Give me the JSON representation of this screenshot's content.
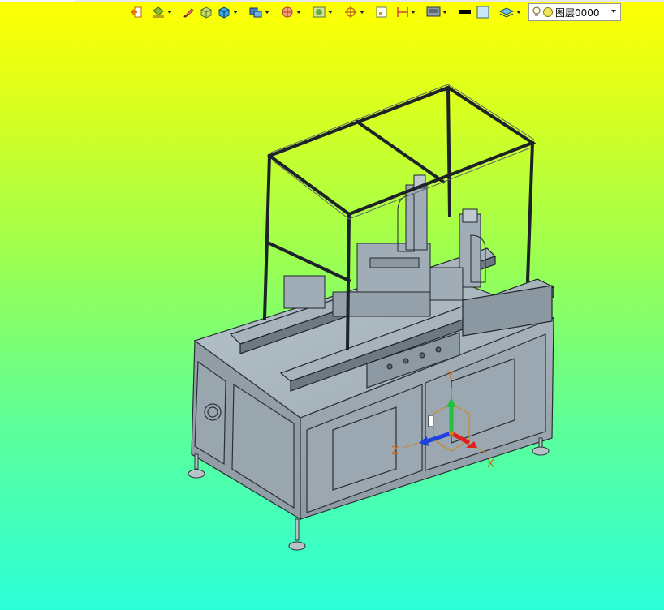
{
  "toolbar": {
    "layer": {
      "label": "图层0000"
    },
    "tools": [
      {
        "name": "exit-sketch",
        "icon": "exit-arrow-icon"
      },
      {
        "name": "paint-bucket",
        "icon": "paint-bucket-icon",
        "has_menu": true
      },
      {
        "name": "brush",
        "icon": "brush-icon"
      },
      {
        "name": "solid-box",
        "icon": "solid-box-icon"
      },
      {
        "name": "shaded-cube",
        "icon": "shaded-cube-icon",
        "has_menu": true
      },
      {
        "name": "views",
        "icon": "view-cube-icon",
        "has_menu": true
      },
      {
        "name": "section",
        "icon": "section-icon",
        "has_menu": true
      },
      {
        "name": "render",
        "icon": "render-icon",
        "has_menu": true
      },
      {
        "name": "snap",
        "icon": "snap-icon",
        "has_menu": true
      },
      {
        "name": "frame",
        "icon": "frame-icon"
      },
      {
        "name": "dimension",
        "icon": "dimension-icon",
        "has_menu": true
      },
      {
        "name": "display",
        "icon": "display-icon",
        "has_menu": true
      },
      {
        "name": "line-style",
        "icon": "line-style-icon"
      },
      {
        "name": "color",
        "icon": "color-swatch-icon"
      },
      {
        "name": "layers",
        "icon": "layers-icon",
        "has_menu": true
      }
    ]
  },
  "viewport": {
    "axis_labels": {
      "x": "X",
      "y": "Y",
      "z": "Z"
    },
    "colors": {
      "bg_top": "#ffff00",
      "bg_bottom": "#2bffd8",
      "machine_body": "#9aa8b2",
      "frame": "#20262c",
      "axis_x": "#e02020",
      "axis_y": "#20c040",
      "axis_z": "#2040e0",
      "triad_outline": "#c88a20"
    }
  }
}
